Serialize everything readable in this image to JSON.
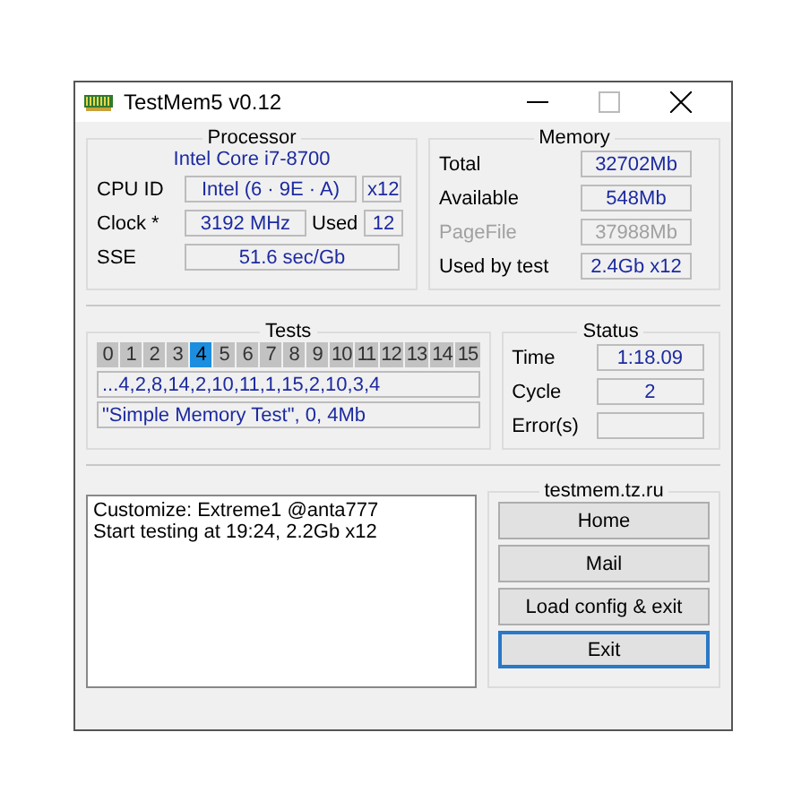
{
  "window": {
    "title": "TestMem5 v0.12"
  },
  "processor": {
    "title": "Processor",
    "name": "Intel Core i7-8700",
    "cpu_id": {
      "label": "CPU ID",
      "value": "Intel  (6 · 9E · A)",
      "threads": "x12"
    },
    "clock": {
      "label": "Clock *",
      "value": "3192 MHz",
      "used_label": "Used",
      "used": "12"
    },
    "sse": {
      "label": "SSE",
      "value": "51.6 sec/Gb"
    }
  },
  "memory": {
    "title": "Memory",
    "rows": [
      {
        "label": "Total",
        "value": "32702Mb",
        "disabled": false
      },
      {
        "label": "Available",
        "value": "548Mb",
        "disabled": false
      },
      {
        "label": "PageFile",
        "value": "37988Mb",
        "disabled": true
      },
      {
        "label": "Used by test",
        "value": "2.4Gb x12",
        "disabled": false
      }
    ]
  },
  "tests": {
    "title": "Tests",
    "cells": [
      {
        "label": "0",
        "selected": false
      },
      {
        "label": "1",
        "selected": false
      },
      {
        "label": "2",
        "selected": false
      },
      {
        "label": "3",
        "selected": false
      },
      {
        "label": "4",
        "selected": true
      },
      {
        "label": "5",
        "selected": false
      },
      {
        "label": "6",
        "selected": false
      },
      {
        "label": "7",
        "selected": false
      },
      {
        "label": "8",
        "selected": false
      },
      {
        "label": "9",
        "selected": false
      },
      {
        "label": "10",
        "selected": false
      },
      {
        "label": "11",
        "selected": false
      },
      {
        "label": "12",
        "selected": false
      },
      {
        "label": "13",
        "selected": false
      },
      {
        "label": "14",
        "selected": false
      },
      {
        "label": "15",
        "selected": false
      }
    ],
    "sequence": "...4,2,8,14,2,10,11,1,15,2,10,3,4",
    "current": "\"Simple Memory Test\", 0, 4Mb"
  },
  "status": {
    "title": "Status",
    "rows": [
      {
        "label": "Time",
        "value": "1:18.09"
      },
      {
        "label": "Cycle",
        "value": "2"
      },
      {
        "label": "Error(s)"
      }
    ]
  },
  "log": [
    "Customize: Extreme1 @anta777",
    "Start testing at 19:24, 2.2Gb x12"
  ],
  "links": {
    "title": "testmem.tz.ru",
    "buttons": [
      {
        "label": "Home",
        "selected": false
      },
      {
        "label": "Mail",
        "selected": false
      },
      {
        "label": "Load config & exit",
        "selected": false
      },
      {
        "label": "Exit",
        "selected": true
      }
    ]
  }
}
